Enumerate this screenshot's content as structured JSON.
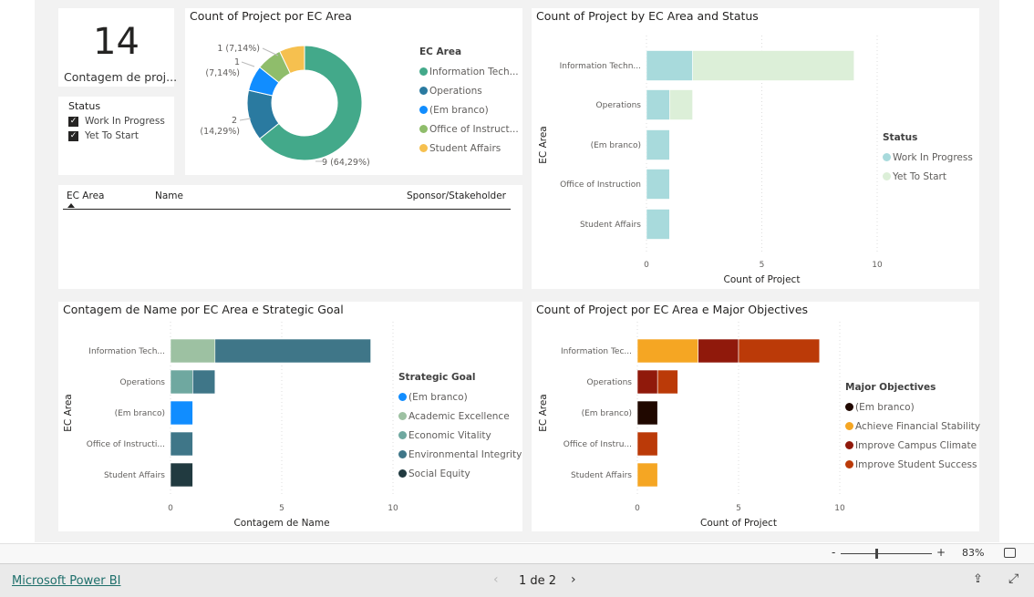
{
  "card": {
    "value": "14",
    "label": "Contagem de proj..."
  },
  "slicer": {
    "title": "Status",
    "items": [
      {
        "label": "Work In Progress",
        "checked": true
      },
      {
        "label": "Yet To Start",
        "checked": true
      }
    ]
  },
  "table": {
    "columns": [
      "EC Area",
      "Name",
      "Sponsor/Stakeholder"
    ],
    "sort_icon": "sort-ascending-icon"
  },
  "donut": {
    "title": "Count of Project por EC Area",
    "legend_title": "EC Area",
    "chart_data": {
      "type": "pie",
      "categories": [
        "Information Tech...",
        "Operations",
        "(Em branco)",
        "Office of Instruct...",
        "Student Affairs"
      ],
      "values": [
        9,
        2,
        1,
        1,
        1
      ],
      "labels": [
        "9 (64,29%)",
        "2 (14,29%)",
        "1 (7,14%)",
        "1 (7,14%)",
        "1 (7,14%)"
      ],
      "colors": [
        "#43a98a",
        "#2a7aa0",
        "#118dff",
        "#8fbd6b",
        "#f6c04f"
      ],
      "legend": "right"
    }
  },
  "status_chart": {
    "title": "Count of Project by EC Area and Status",
    "chart_data": {
      "type": "bar",
      "orientation": "horizontal",
      "stacked": true,
      "categories": [
        "Information Techn...",
        "Operations",
        "(Em branco)",
        "Office of Instruction",
        "Student Affairs"
      ],
      "series": [
        {
          "name": "Work In Progress",
          "values": [
            2,
            1,
            1,
            1,
            1
          ],
          "color": "#a8dadc"
        },
        {
          "name": "Yet To Start",
          "values": [
            7,
            1,
            0,
            0,
            0
          ],
          "color": "#dcefd8"
        }
      ],
      "xlabel": "Count of Project",
      "ylabel": "EC Area",
      "xlim": [
        0,
        10
      ],
      "xticks": [
        "0",
        "5",
        "10"
      ],
      "legend_title": "Status",
      "legend": "right",
      "grid": true
    }
  },
  "strategic_chart": {
    "title": "Contagem de Name por EC Area e Strategic Goal",
    "chart_data": {
      "type": "bar",
      "orientation": "horizontal",
      "stacked": true,
      "categories": [
        "Information Tech...",
        "Operations",
        "(Em branco)",
        "Office of Instructi...",
        "Student Affairs"
      ],
      "series": [
        {
          "name": "(Em branco)",
          "values": [
            0,
            0,
            1,
            0,
            0
          ],
          "color": "#118dff"
        },
        {
          "name": "Academic Excellence",
          "values": [
            2,
            0,
            0,
            0,
            0
          ],
          "color": "#9dc1a2"
        },
        {
          "name": "Economic Vitality",
          "values": [
            0,
            1,
            0,
            0,
            0
          ],
          "color": "#6fa8a0"
        },
        {
          "name": "Environmental Integrity",
          "values": [
            7,
            1,
            0,
            1,
            0
          ],
          "color": "#3f7688"
        },
        {
          "name": "Social Equity",
          "values": [
            0,
            0,
            0,
            0,
            1
          ],
          "color": "#213a40"
        }
      ],
      "xlabel": "Contagem de Name",
      "ylabel": "EC Area",
      "xlim": [
        0,
        10
      ],
      "xticks": [
        "0",
        "5",
        "10"
      ],
      "legend_title": "Strategic Goal",
      "legend": "right",
      "grid": true
    }
  },
  "objectives_chart": {
    "title": "Count of Project por EC Area e Major Objectives",
    "chart_data": {
      "type": "bar",
      "orientation": "horizontal",
      "stacked": true,
      "categories": [
        "Information Tec...",
        "Operations",
        "(Em branco)",
        "Office of Instru...",
        "Student Affairs"
      ],
      "series": [
        {
          "name": "(Em branco)",
          "values": [
            0,
            0,
            1,
            0,
            0
          ],
          "color": "#200800"
        },
        {
          "name": "Achieve Financial Stability",
          "values": [
            3,
            0,
            0,
            0,
            1
          ],
          "color": "#f5a623"
        },
        {
          "name": "Improve Campus Climate",
          "values": [
            2,
            1,
            0,
            0,
            0
          ],
          "color": "#90190b"
        },
        {
          "name": "Improve Student Success",
          "values": [
            4,
            1,
            0,
            1,
            0
          ],
          "color": "#bb3a08"
        }
      ],
      "xlabel": "Count of Project",
      "ylabel": "EC Area",
      "xlim": [
        0,
        10
      ],
      "xticks": [
        "0",
        "5",
        "10"
      ],
      "legend_title": "Major Objectives",
      "legend": "right",
      "grid": true
    }
  },
  "zoom": {
    "minus": "-",
    "plus": "+",
    "level": "83%",
    "level_value": 83
  },
  "footer": {
    "brand": "Microsoft Power BI",
    "page": "1 de 2"
  }
}
